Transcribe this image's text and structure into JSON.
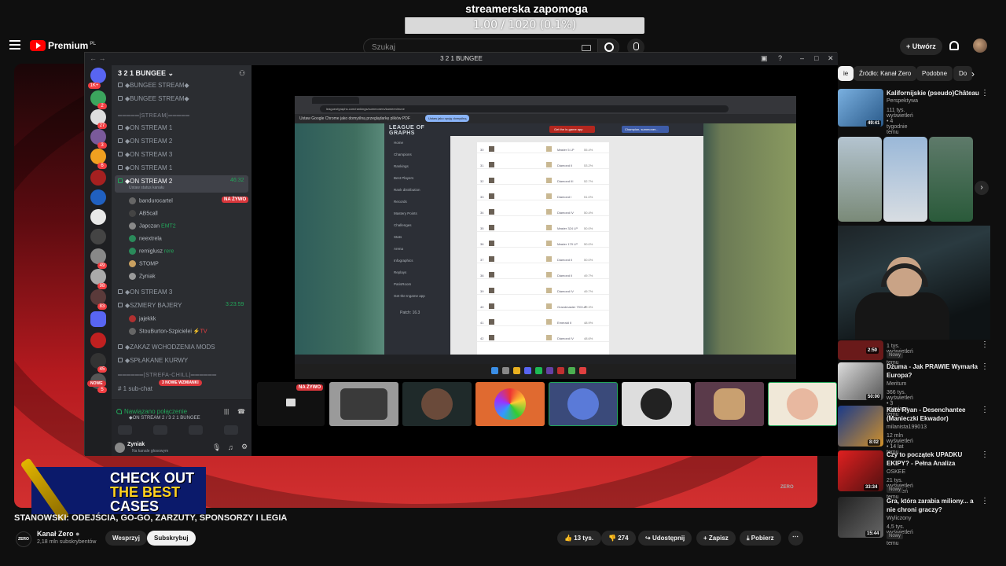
{
  "overlay": {
    "title": "streamerska zapomoga",
    "progress_text": "1.00 / 1020 (0.1%)",
    "progress_fraction": 0.001
  },
  "youtube": {
    "brand": "Premium",
    "region": "PL",
    "search_placeholder": "Szukaj",
    "create_label": "Utwórz",
    "chips": [
      "ie",
      "Źródło: Kanał Zero",
      "Podobne",
      "Do"
    ],
    "video_title": "STANOWSKI: ODEJŚCIA, GO-GO, ZARZUTY, SPONSORZY I LEGIA",
    "channel_name": "Kanał Zero",
    "channel_avatar": "ZERO",
    "channel_subs": "2,18 mln subskrybentów",
    "support_label": "Wesprzyj",
    "subscribe_label": "Subskrybuj",
    "likes": "13 tys.",
    "dislikes": "274",
    "share_label": "Udostępnij",
    "save_label": "Zapisz",
    "download_label": "Pobierz",
    "promo_lines": [
      "CHECK OUT",
      "THE BEST",
      "CASES"
    ],
    "watermark": "ZERO",
    "recommended": [
      {
        "title": "Kalifornijskie (pseudo)Château",
        "channel": "Perspektywa",
        "meta": "111 tys. wyświetleń • 4 tygodnie temu",
        "duration": "49:41",
        "thumb": "#3b6a9a"
      },
      {
        "title": "",
        "channel": "",
        "meta": "1 tys. wyświetleń • 2 dni temu",
        "duration": "2:50",
        "new": "Nowy",
        "thumb": "#6a1a1a"
      },
      {
        "title": "Dżuma - Jak PRAWIE Wymarła Europa?",
        "channel": "Meritum",
        "meta": "366 tys. wyświetleń • 3 miesiące temu",
        "duration": "50:00",
        "thumb": "#2a2a2a"
      },
      {
        "title": "Kate Ryan - Desenchantee (Manieczki Ekwador)",
        "channel": "milanista199013",
        "meta": "12 mln wyświetleń • 14 lat temu",
        "duration": "8:02",
        "thumb": "#5a3a1a"
      },
      {
        "title": "Czy to początek UPADKU EKIPY? - Pełna Analiza",
        "channel": "OSKEE",
        "meta": "21 tys. wyświetleń • 1 dzień temu",
        "duration": "33:34",
        "new": "Nowy",
        "thumb": "#8a1a10"
      },
      {
        "title": "Gra, która zarabia miliony... a nie chroni graczy?",
        "channel": "Wyliczony",
        "meta": "4,5 tys. wyświetleń • 2 dni temu",
        "duration": "15:44",
        "new": "Nowy",
        "thumb": "#3a3a3a"
      }
    ]
  },
  "discord": {
    "window_title": "3 2 1 BUNGEE",
    "server_name": "3 2 1 BUNGEE",
    "channels": [
      {
        "name": "◆BUNGEE STREAM◆",
        "type": "voice"
      },
      {
        "name": "◆BUNGEE STREAM◆",
        "type": "voice"
      },
      {
        "name": "═════|STREAM|═════",
        "type": "category"
      },
      {
        "name": "◆ON STREAM 1",
        "type": "voice"
      },
      {
        "name": "◆ON STREAM 2",
        "type": "voice"
      },
      {
        "name": "◆ON STREAM 3",
        "type": "voice"
      },
      {
        "name": "◆ON STREAM 1",
        "type": "voice"
      },
      {
        "name": "◆ON STREAM 2",
        "type": "voice",
        "active": true,
        "timer": "46:32",
        "status": "Ustaw status kanału"
      }
    ],
    "members": [
      "bandurocartel",
      "AB5call",
      "Japczan",
      "neextrela",
      "remiglusz",
      "STOMP",
      "Zyniak"
    ],
    "member_tags": {
      "Japczan": "EMT2",
      "remiglusz": "rere"
    },
    "live_label": "NA ŻYWO",
    "channels2": [
      {
        "name": "◆ON STREAM 3",
        "type": "voice"
      },
      {
        "name": "◆SZMERY BAJERY",
        "type": "voice",
        "timer": "3:23:59"
      }
    ],
    "members2": [
      "jajekkk",
      "StouBurton-Szpicielei"
    ],
    "channels3": [
      {
        "name": "◆ZAKAZ WCHODZENIA MODS",
        "type": "voice"
      },
      {
        "name": "◆SPŁAKANE KURWY",
        "type": "voice"
      },
      {
        "name": "══════|STREFA-CHILL|══════",
        "type": "category"
      },
      {
        "name": "1 sub-chat",
        "type": "text"
      }
    ],
    "new_mentions": "3 NOWE WZMIANKI",
    "new_label": "NOWE",
    "connection_status": "Nawiązano połączenie",
    "connection_channel": "◆ON STREAM 2 / 3 2 1 BUNGEE",
    "self_name": "Zyniak",
    "self_status": "Na kanale głosowym",
    "server_badges": [
      "1K+",
      "2",
      "27",
      "3",
      "6",
      "49",
      "98",
      "83",
      "45",
      "5"
    ]
  },
  "shared_screen": {
    "url": "leagueofgraphs.com/rankings/summoners/kameen/eune",
    "notice": "Ustaw Google Chrome jako domyślną przeglądarkę plików PDF",
    "notice_btn": "Ustaw jako opcję domyślną",
    "logo": "LEAGUE OF GRAPHS",
    "nav": [
      "Home",
      "Champions",
      "Rankings",
      "Best Players",
      "Rank distribution",
      "Records",
      "Mastery Points",
      "Challenges",
      "Stats",
      "Arena",
      "Infographics",
      "Replays",
      "ParisRoom",
      "Get the Ingame app"
    ],
    "patch": "Patch: 16.3",
    "get_app": "Get the in-game app",
    "selector": "Champion, summoner...",
    "rows": [
      {
        "rank": "30",
        "tier": "Master 5 LP",
        "pct": "55.4%"
      },
      {
        "rank": "31",
        "tier": "Diamond II",
        "pct": "53.2%"
      },
      {
        "rank": "32",
        "tier": "Diamond III",
        "pct": "52.7%"
      },
      {
        "rank": "33",
        "tier": "Diamond I",
        "pct": "51.0%"
      },
      {
        "rank": "34",
        "tier": "Diamond IV",
        "pct": "50.4%"
      },
      {
        "rank": "35",
        "tier": "Master 324 LP",
        "pct": "50.0%"
      },
      {
        "rank": "36",
        "tier": "Master 179 LP",
        "pct": "50.0%"
      },
      {
        "rank": "37",
        "tier": "Diamond II",
        "pct": "50.0%"
      },
      {
        "rank": "38",
        "tier": "Diamond II",
        "pct": "49.7%"
      },
      {
        "rank": "39",
        "tier": "Diamond IV",
        "pct": "49.7%"
      },
      {
        "rank": "40",
        "tier": "Grandmaster 793 LP",
        "pct": "49.3%"
      },
      {
        "rank": "41",
        "tier": "Emerald II",
        "pct": "48.9%"
      },
      {
        "rank": "42",
        "tier": "Diamond IV",
        "pct": "48.6%"
      }
    ]
  }
}
